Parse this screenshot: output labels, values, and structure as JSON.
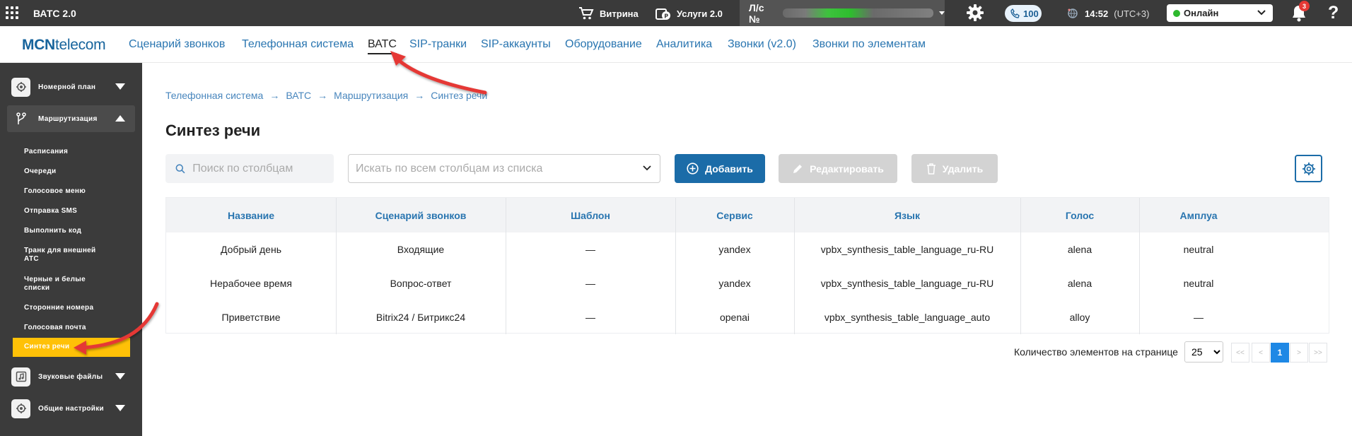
{
  "topbar": {
    "app_title": "ВАТС 2.0",
    "showcase_label": "Витрина",
    "services_label": "Услуги 2.0",
    "account_label": "Л/с №",
    "calls_count": "100",
    "time": "14:52",
    "timezone": "(UTC+3)",
    "status": "Онлайн",
    "notifications_count": "3",
    "help": "?"
  },
  "nav": {
    "logo_bold": "MCN",
    "logo_rest": "telecom",
    "items": [
      "Сценарий звонков",
      "Телефонная система",
      "ВАТС",
      "SIP-транки",
      "SIP-аккаунты",
      "Оборудование",
      "Аналитика",
      "Звонки (v2.0)",
      "Звонки по элементам"
    ],
    "active": "ВАТС"
  },
  "sidebar": {
    "groups": {
      "number_plan": "Номерной план",
      "routing": "Маршрутизация",
      "sound_files": "Звуковые файлы",
      "general": "Общие настройки"
    },
    "routing_items": [
      "Расписания",
      "Очереди",
      "Голосовое меню",
      "Отправка SMS",
      "Выполнить код",
      "Транк для внешней АТС",
      "Черные и белые списки",
      "Сторонние номера",
      "Голосовая почта",
      "Синтез речи"
    ],
    "active_item": "Синтез речи"
  },
  "breadcrumb": [
    "Телефонная система",
    "ВАТС",
    "Маршрутизация",
    "Синтез речи"
  ],
  "page_title": "Синтез речи",
  "toolbar": {
    "search_columns_placeholder": "Поиск по столбцам",
    "search_all_placeholder": "Искать по всем столбцам из списка",
    "add_label": "Добавить",
    "edit_label": "Редактировать",
    "delete_label": "Удалить"
  },
  "table": {
    "columns": [
      "Название",
      "Сценарий звонков",
      "Шаблон",
      "Сервис",
      "Язык",
      "Голос",
      "Амплуа"
    ],
    "rows": [
      [
        "Добрый день",
        "Входящие",
        "—",
        "yandex",
        "vpbx_synthesis_table_language_ru-RU",
        "alena",
        "neutral"
      ],
      [
        "Нерабочее время",
        "Вопрос-ответ",
        "—",
        "yandex",
        "vpbx_synthesis_table_language_ru-RU",
        "alena",
        "neutral"
      ],
      [
        "Приветствие",
        "Bitrix24 / Битрикс24",
        "—",
        "openai",
        "vpbx_synthesis_table_language_auto",
        "alloy",
        "—"
      ]
    ]
  },
  "pagination": {
    "per_page_label": "Количество элементов на странице",
    "per_page": "25",
    "first": "<<",
    "prev": "<",
    "current": "1",
    "next": ">",
    "last": ">>"
  },
  "colors": {
    "topbar_bg": "#3a3a3a",
    "sidebar_bg": "#3b3b3b",
    "accent": "#1b6ca8",
    "active_item": "#ffc107",
    "link": "#2975b0",
    "annotation_arrow": "#e53935"
  }
}
